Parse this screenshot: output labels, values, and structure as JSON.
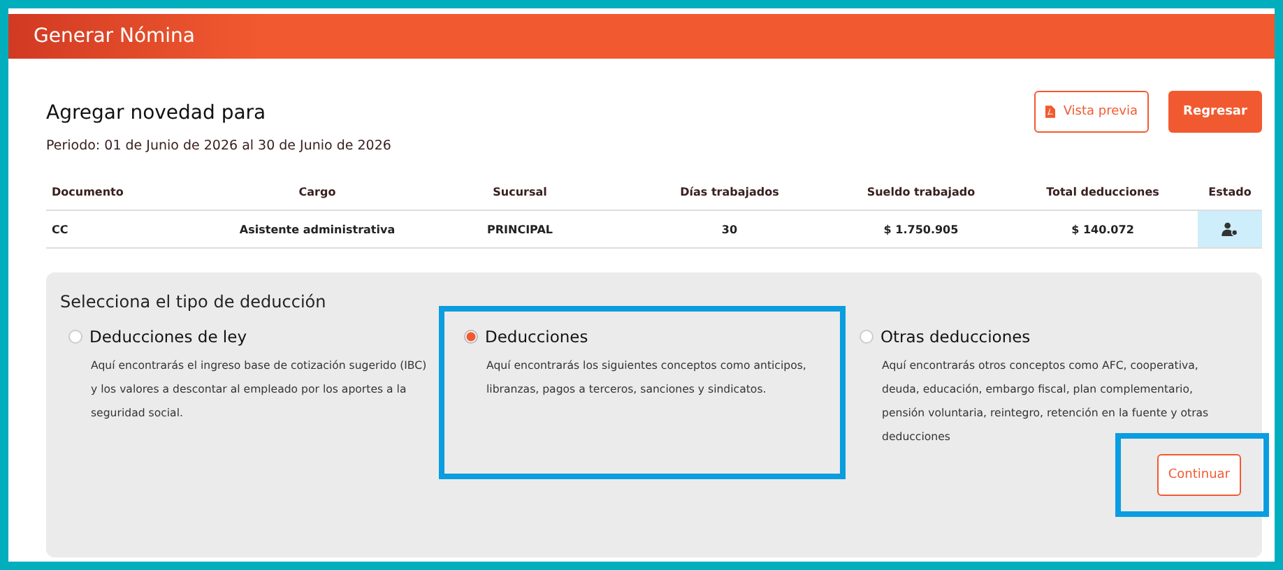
{
  "header": {
    "title": "Generar Nómina"
  },
  "page": {
    "heading": "Agregar novedad para",
    "period": "Periodo: 01 de Junio de 2026 al 30 de Junio de 2026",
    "buttons": [
      {
        "label": "Vista previa",
        "kind": "outline"
      },
      {
        "label": "Regresar",
        "kind": "primary"
      }
    ]
  },
  "table": {
    "columns": [
      "Documento",
      "Cargo",
      "Sucursal",
      "Días trabajados",
      "Sueldo trabajado",
      "Total deducciones",
      "Estado"
    ],
    "rows": [
      {
        "cells": [
          "CC",
          "Asistente administrativa",
          "PRINCIPAL",
          "30",
          "$ 1.750.905",
          "$ 140.072"
        ]
      }
    ]
  },
  "deductions": {
    "title": "Selecciona el tipo de deducción",
    "options": [
      {
        "label": "Deducciones de ley",
        "description": "Aquí encontrarás el ingreso base de cotización sugerido (IBC) y los valores a descontar al empleado por los aportes a la seguridad social.",
        "selected": false,
        "highlighted": false
      },
      {
        "label": "Deducciones",
        "description": "Aquí encontrarás los siguientes conceptos como anticipos, libranzas, pagos a terceros, sanciones y sindicatos.",
        "selected": true,
        "highlighted": true
      },
      {
        "label": "Otras deducciones",
        "description": "Aquí encontrarás otros conceptos como AFC, cooperativa, deuda, educación, embargo fiscal, plan complementario, pensión voluntaria, reintegro, retención en la fuente y otras deducciones",
        "selected": false,
        "highlighted": false
      }
    ],
    "continue": {
      "label": "Continuar",
      "highlighted": true
    }
  }
}
